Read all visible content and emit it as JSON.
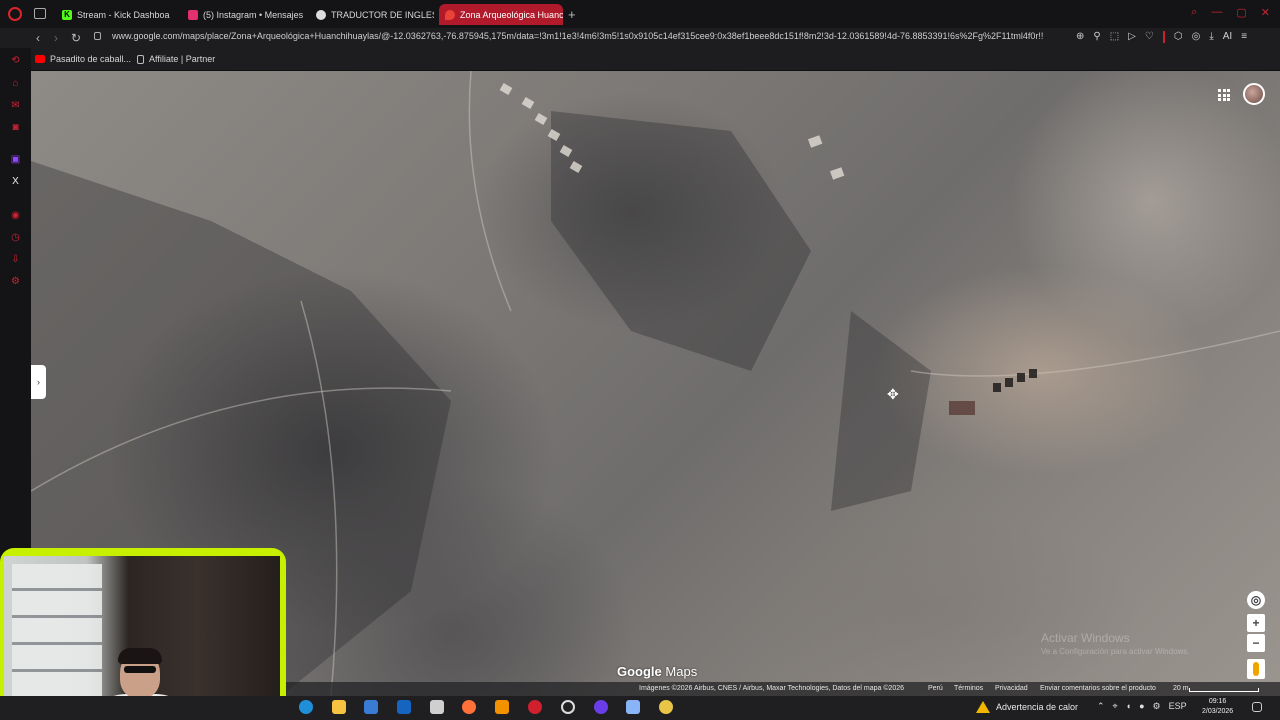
{
  "browser": {
    "tabs": [
      {
        "label": "Stream - Kick Dashboa",
        "icon": "kick-icon",
        "color": "#53fc18"
      },
      {
        "label": "(5) Instagram • Mensajes",
        "icon": "instagram-icon",
        "color": "#e1306c"
      },
      {
        "label": "TRADUCTOR DE INGLES",
        "icon": "translate-icon",
        "color": "#dddddd"
      },
      {
        "label": "Zona Arqueológica Huanc",
        "icon": "maps-pin-icon",
        "color": "#ea4335",
        "active": true
      }
    ],
    "url": "www.google.com/maps/place/Zona+Arqueológica+Huanchihuaylas/@-12.0362763,-76.875945,175m/data=!3m1!1e3!4m6!3m5!1s0x9105c14ef315cee9:0x38ef1beee8dc151f!8m2!3d-12.0361589!4d-76.8853391!6s%2Fg%2F11tml4f0r!!",
    "ai_label": "AI",
    "bookmarks": [
      {
        "label": "Pasadito de caball...",
        "icon": "youtube-icon"
      },
      {
        "label": "Affiliate | Partner",
        "icon": "page-icon"
      }
    ],
    "accent": "#b11a2a"
  },
  "map": {
    "logo_google": "Google",
    "logo_maps": "Maps",
    "attribution": "Imágenes ©2026 Airbus, CNES / Airbus, Maxar Technologies, Datos del mapa ©2026",
    "links": [
      "Perú",
      "Términos",
      "Privacidad",
      "Enviar comentarios sobre el producto"
    ],
    "scale": "20 m",
    "watermark_title": "Activar Windows",
    "watermark_sub": "Ve a Configuración para activar Windows.",
    "controls": {
      "zoom_in": "+",
      "zoom_out": "−"
    }
  },
  "taskbar": {
    "weather": "Advertencia de calor",
    "lang": "ESP",
    "time": "09:16",
    "date": "2/03/2026"
  }
}
